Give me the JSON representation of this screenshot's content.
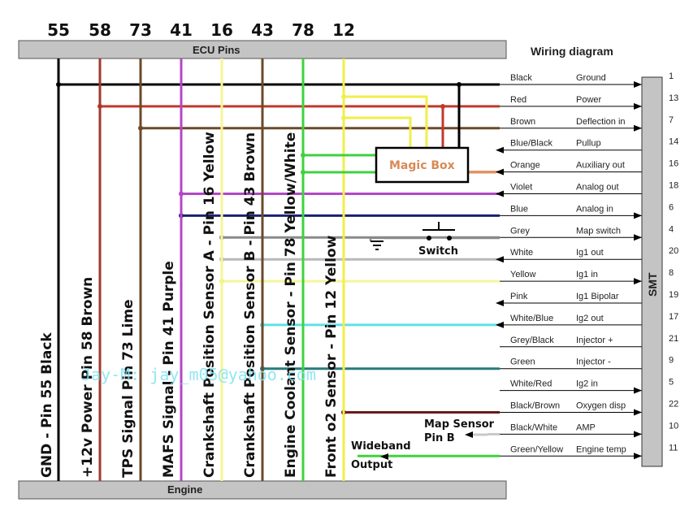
{
  "title": "Wiring diagram",
  "ecu_bar_label": "ECU Pins",
  "engine_bar_label": "Engine",
  "smt_label": "SMT",
  "magic_box_label": "Magic Box",
  "switch_label": "Switch",
  "map_sensor_note": [
    "Map Sensor",
    "Pin B"
  ],
  "wideband_note": [
    "Wideband",
    "Output"
  ],
  "watermark": "Jay-M: jay_m05@yahoo.com",
  "ecu_columns": [
    {
      "pin": "55",
      "label": "GND - Pin 55  Black",
      "color": "#000000"
    },
    {
      "pin": "58",
      "label": "+12v Power Pin 58 Brown",
      "color": "#a33a2e"
    },
    {
      "pin": "73",
      "label": "TPS Signal  Pin 73 Lime",
      "color": "#6b4a2a"
    },
    {
      "pin": "41",
      "label": "MAFS Signal - Pin 41 Purple",
      "color": "#b447c8"
    },
    {
      "pin": "16",
      "label": "Crankshaft Position Sensor A - Pin 16 Yellow",
      "color": "#f6f59a"
    },
    {
      "pin": "43",
      "label": "Crankshaft Position Sensor B - Pin 43 Brown",
      "color": "#6b4a2a"
    },
    {
      "pin": "78",
      "label": "Engine Coolant Sensor - Pin 78 Yellow/White",
      "color": "#3fd23f"
    },
    {
      "pin": "12",
      "label": "Front o2 Sensor - Pin 12 Yellow",
      "color": "#f2ee4a"
    }
  ],
  "smt_rows": [
    {
      "wire": "Black",
      "function": "Ground",
      "pin": "1",
      "color": "#000000",
      "dir": "in"
    },
    {
      "wire": "Red",
      "function": "Power",
      "pin": "13",
      "color": "#c0392b",
      "dir": "in"
    },
    {
      "wire": "Brown",
      "function": "Deflection in",
      "pin": "7",
      "color": "#6b4a2a",
      "dir": "in"
    },
    {
      "wire": "Blue/Black",
      "function": "Pullup",
      "pin": "14",
      "color": "#ffffff",
      "dir": "out"
    },
    {
      "wire": "Orange",
      "function": "Auxiliary out",
      "pin": "16",
      "color": "#e09060",
      "dir": "out"
    },
    {
      "wire": "Violet",
      "function": "Analog out",
      "pin": "18",
      "color": "#b447c8",
      "dir": "out"
    },
    {
      "wire": "Blue",
      "function": "Analog in",
      "pin": "6",
      "color": "#1a2070",
      "dir": "in"
    },
    {
      "wire": "Grey",
      "function": "Map switch",
      "pin": "4",
      "color": "#8a8a8a",
      "dir": "in"
    },
    {
      "wire": "White",
      "function": "Ig1 out",
      "pin": "20",
      "color": "#b8b8b8",
      "dir": "out"
    },
    {
      "wire": "Yellow",
      "function": "Ig1 in",
      "pin": "8",
      "color": "#f6f59a",
      "dir": "in"
    },
    {
      "wire": "Pink",
      "function": "Ig1 Bipolar",
      "pin": "19",
      "color": "#ffffff",
      "dir": "out"
    },
    {
      "wire": "White/Blue",
      "function": "Ig2 out",
      "pin": "17",
      "color": "#5fe0e6",
      "dir": "out"
    },
    {
      "wire": "Grey/Black",
      "function": "Injector +",
      "pin": "21",
      "color": "#ffffff",
      "dir": "none"
    },
    {
      "wire": "Green",
      "function": "Injector -",
      "pin": "9",
      "color": "#2a7a7a",
      "dir": "none"
    },
    {
      "wire": "White/Red",
      "function": "Ig2 in",
      "pin": "5",
      "color": "#ffffff",
      "dir": "in"
    },
    {
      "wire": "Black/Brown",
      "function": "Oxygen disp",
      "pin": "22",
      "color": "#6a1a1a",
      "dir": "in"
    },
    {
      "wire": "Black/White",
      "function": "AMP",
      "pin": "10",
      "color": "#c8c8c8",
      "dir": "in"
    },
    {
      "wire": "Green/Yellow",
      "function": "Engine temp",
      "pin": "11",
      "color": "#3fd23f",
      "dir": "in"
    }
  ]
}
